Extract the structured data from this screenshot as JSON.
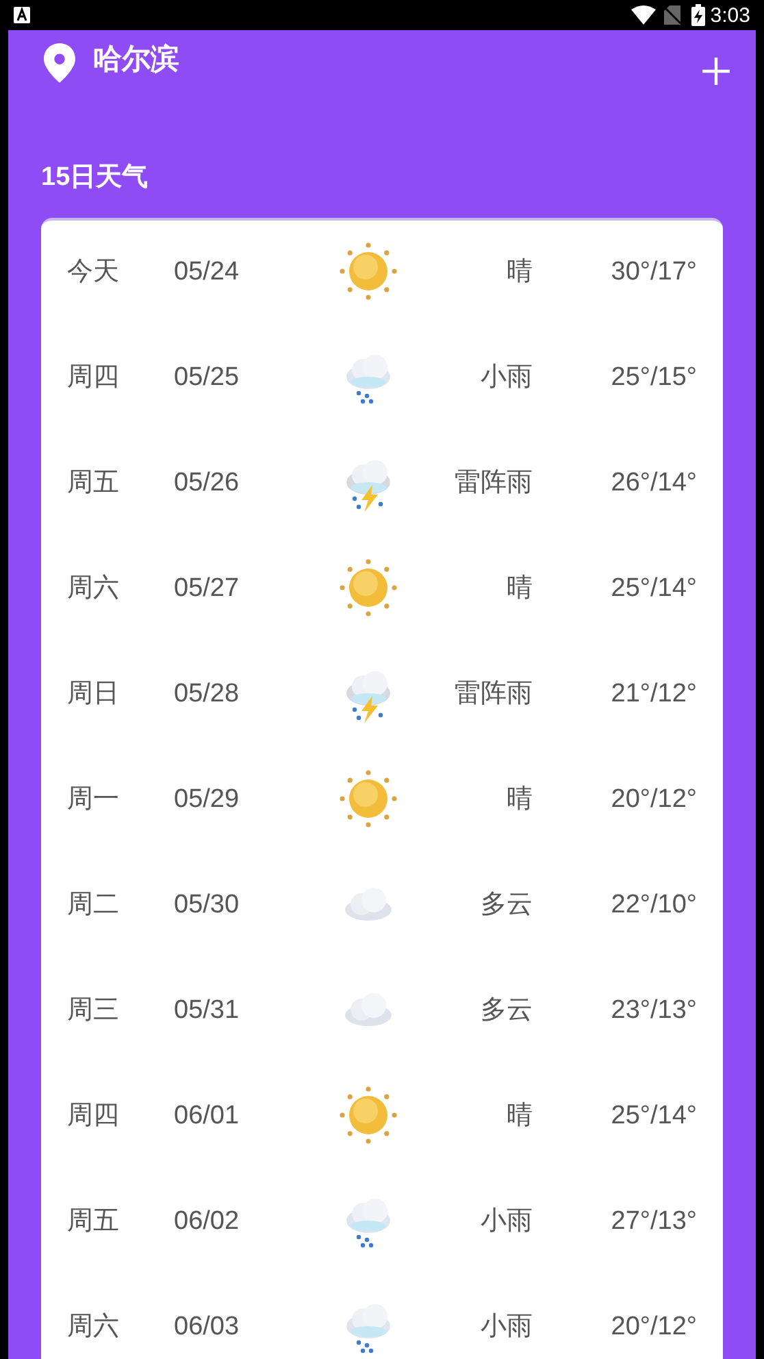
{
  "status_bar": {
    "time": "3:03"
  },
  "header": {
    "city": "哈尔滨"
  },
  "section_title": "15日天气",
  "days": [
    {
      "day": "今天",
      "date": "05/24",
      "kind": "sunny",
      "condition": "晴",
      "temp": "30°/17°"
    },
    {
      "day": "周四",
      "date": "05/25",
      "kind": "rain",
      "condition": "小雨",
      "temp": "25°/15°"
    },
    {
      "day": "周五",
      "date": "05/26",
      "kind": "thunder",
      "condition": "雷阵雨",
      "temp": "26°/14°"
    },
    {
      "day": "周六",
      "date": "05/27",
      "kind": "sunny",
      "condition": "晴",
      "temp": "25°/14°"
    },
    {
      "day": "周日",
      "date": "05/28",
      "kind": "thunder",
      "condition": "雷阵雨",
      "temp": "21°/12°"
    },
    {
      "day": "周一",
      "date": "05/29",
      "kind": "sunny",
      "condition": "晴",
      "temp": "20°/12°"
    },
    {
      "day": "周二",
      "date": "05/30",
      "kind": "cloudy",
      "condition": "多云",
      "temp": "22°/10°"
    },
    {
      "day": "周三",
      "date": "05/31",
      "kind": "cloudy",
      "condition": "多云",
      "temp": "23°/13°"
    },
    {
      "day": "周四",
      "date": "06/01",
      "kind": "sunny",
      "condition": "晴",
      "temp": "25°/14°"
    },
    {
      "day": "周五",
      "date": "06/02",
      "kind": "rain",
      "condition": "小雨",
      "temp": "27°/13°"
    },
    {
      "day": "周六",
      "date": "06/03",
      "kind": "rain",
      "condition": "小雨",
      "temp": "20°/12°"
    }
  ]
}
